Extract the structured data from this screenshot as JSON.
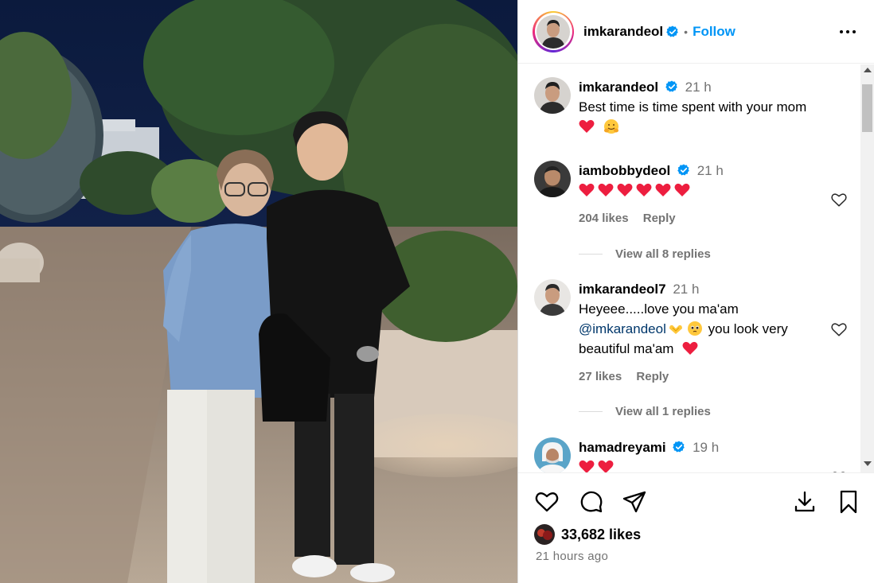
{
  "post": {
    "author": "imkarandeol",
    "follow_label": "Follow",
    "dot": "•",
    "likes_count": "33,682 likes",
    "posted_time": "21 hours ago"
  },
  "caption": {
    "username": "imkarandeol",
    "time": "21 h",
    "text": "Best time is time spent with your mom"
  },
  "comments": [
    {
      "username": "iambobbydeol",
      "time": "21 h",
      "likes": "204 likes",
      "reply_label": "Reply",
      "view_replies": "View all 8 replies"
    },
    {
      "username": "imkarandeol7",
      "time": "21 h",
      "text_line1": "Heyeee.....love you ma'am",
      "mention": "@imkarandeol",
      "text_line2": "you look very",
      "text_line3": "beautiful ma'am",
      "likes": "27 likes",
      "reply_label": "Reply",
      "view_replies": "View all 1 replies"
    },
    {
      "username": "hamadreyami",
      "time": "19 h"
    }
  ],
  "colors": {
    "accent": "#0095f6",
    "verified": "#0095f6",
    "heart": "#ed1e3f",
    "secondary_text": "#737373"
  },
  "icons": [
    "more-icon",
    "verified-icon",
    "heart-icon",
    "comment-icon",
    "share-icon",
    "download-icon",
    "save-icon"
  ]
}
